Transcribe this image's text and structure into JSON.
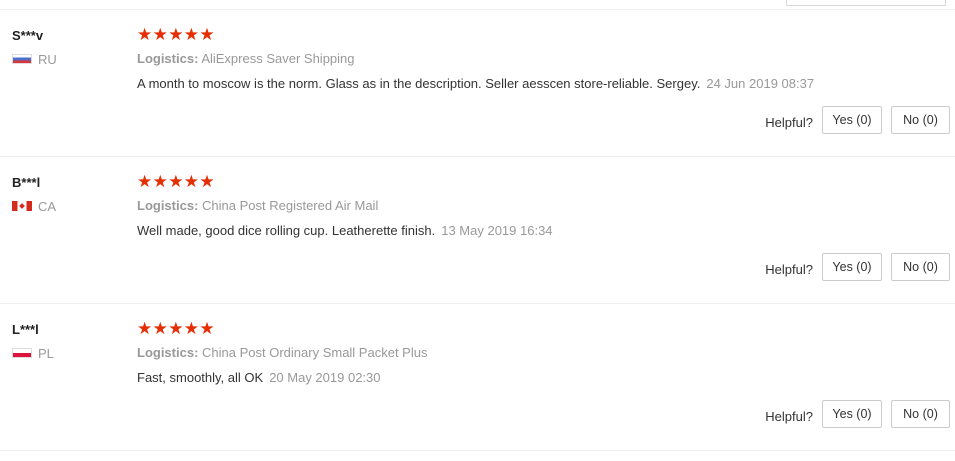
{
  "reviews": [
    {
      "user": "S***v",
      "country_code": "RU",
      "flag": "russia-flag-icon",
      "rating": 5,
      "stars": "★★★★★",
      "logistics_label": "Logistics:",
      "logistics_value": "AliExpress Saver Shipping",
      "text": "A month to moscow is the norm. Glass as in the description. Seller aesscen store-reliable. Sergey.",
      "date": "24 Jun 2019 08:37",
      "helpful_label": "Helpful?",
      "yes_label": "Yes (0)",
      "no_label": "No (0)"
    },
    {
      "user": "B***l",
      "country_code": "CA",
      "flag": "canada-flag-icon",
      "rating": 5,
      "stars": "★★★★★",
      "logistics_label": "Logistics:",
      "logistics_value": "China Post Registered Air Mail",
      "text": "Well made, good dice rolling cup. Leatherette finish.",
      "date": "13 May 2019 16:34",
      "helpful_label": "Helpful?",
      "yes_label": "Yes (0)",
      "no_label": "No (0)"
    },
    {
      "user": "L***l",
      "country_code": "PL",
      "flag": "poland-flag-icon",
      "rating": 5,
      "stars": "★★★★★",
      "logistics_label": "Logistics:",
      "logistics_value": "China Post Ordinary Small Packet Plus",
      "text": "Fast, smoothly, all OK",
      "date": "20 May 2019 02:30",
      "helpful_label": "Helpful?",
      "yes_label": "Yes (0)",
      "no_label": "No (0)"
    }
  ],
  "colors": {
    "star": "#e62e04",
    "muted_text": "#999999",
    "body_text": "#333333",
    "separator": "#eeeeee"
  }
}
